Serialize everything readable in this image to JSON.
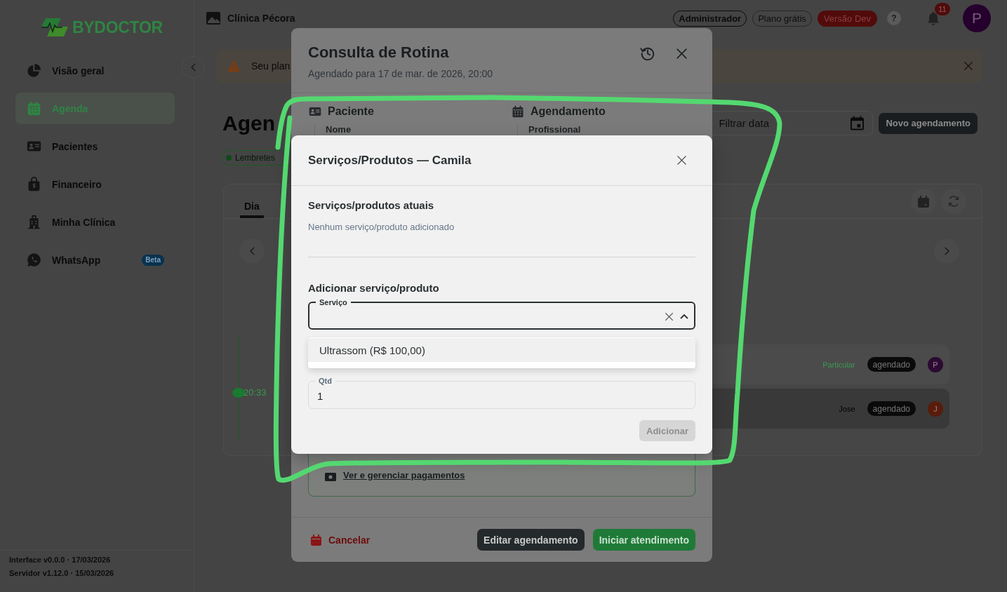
{
  "sidebar": {
    "logo": "BYDOCTOR",
    "items": [
      {
        "label": "Visão geral",
        "selected": false
      },
      {
        "label": "Agenda",
        "selected": true
      },
      {
        "label": "Pacientes",
        "selected": false
      },
      {
        "label": "Financeiro",
        "selected": false
      },
      {
        "label": "Minha Clínica",
        "selected": false
      },
      {
        "label": "WhatsApp",
        "selected": false,
        "badge": "Beta"
      }
    ],
    "footer": [
      "Interface v0.0.0 · 17/03/2026",
      "Servidor v1.12.0 · 15/03/2026"
    ]
  },
  "top_bar": {
    "clinic": "Clínica Pécora",
    "tags": [
      {
        "label": "Administrador",
        "kind": "role"
      },
      {
        "label": "Plano grátis",
        "kind": "plan"
      },
      {
        "label": "Versão Dev",
        "kind": "env"
      }
    ],
    "help": "?",
    "notifications": "11",
    "avatar": "P"
  },
  "banner": {
    "text": "Seu plan"
  },
  "agenda": {
    "title": "Agen",
    "chip": "Lembretes",
    "date_filter": {
      "placeholder": "Filtrar data"
    },
    "new_button": "Novo agendamento",
    "tabs": [
      {
        "label": "Dia",
        "selected": true
      }
    ],
    "current_time": "20:33",
    "appointments": [
      {
        "label": "Particular",
        "kind": "plan",
        "status": "agendado",
        "avatar": "P",
        "color": "#2c0a33",
        "selected": false
      },
      {
        "label": "Jose",
        "kind": "person",
        "status": "agendado",
        "avatar": "J",
        "color": "#5a1c0a",
        "selected": true
      }
    ]
  },
  "appointment_modal": {
    "title": "Consulta de Rotina",
    "subtitle": "Agendado para 17 de mar. de 2026, 20:00",
    "sections": [
      {
        "title": "Paciente",
        "field": "Nome"
      },
      {
        "title": "Agendamento",
        "field": "Profissional"
      }
    ],
    "payment_link": "Ver e gerenciar pagamentos",
    "cancel": "Cancelar",
    "buttons": [
      {
        "label": "Editar agendamento",
        "kind": "secondary"
      },
      {
        "label": "Iniciar atendimento",
        "kind": "primary"
      }
    ]
  },
  "services_modal": {
    "title": "Serviços/Produtos — Camila",
    "current_heading": "Serviços/produtos atuais",
    "empty_text": "Nenhum serviço/produto adicionado",
    "add_heading": "Adicionar serviço/produto",
    "service_select": {
      "label": "Serviço",
      "expanded": true,
      "options": [
        {
          "label": "Ultrassom (R$ 100,00)",
          "highlighted": true
        }
      ]
    },
    "quantity": {
      "label": "Qtd",
      "value": "1"
    },
    "submit": {
      "label": "Adicionar",
      "disabled": true
    }
  },
  "annotation": {
    "kind": "loop"
  }
}
